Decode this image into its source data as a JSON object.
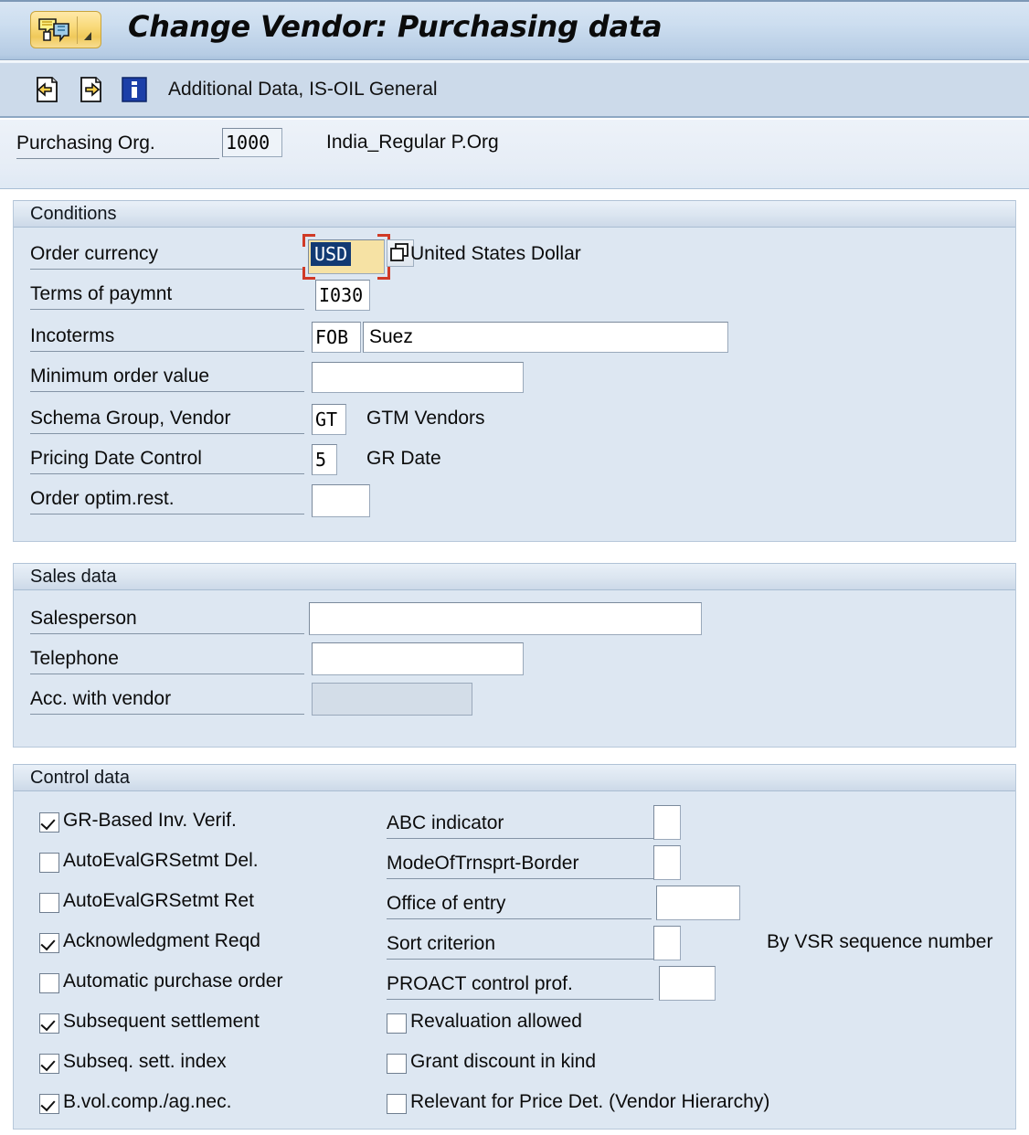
{
  "window": {
    "title": "Change Vendor: Purchasing data",
    "title_icon": "vendor-document-icon",
    "title_dropdown_icon": "caret-down-icon"
  },
  "toolbar": {
    "label": "Additional Data, IS-OIL General",
    "icons": [
      {
        "name": "previous-page-icon",
        "tooltip": "Previous screen"
      },
      {
        "name": "next-page-icon",
        "tooltip": "Next screen"
      },
      {
        "name": "info-icon",
        "tooltip": "Information"
      }
    ]
  },
  "header_fields": {
    "purchasing_org_label": "Purchasing Org.",
    "purchasing_org_value": "1000",
    "purchasing_org_description": "India_Regular P.Org"
  },
  "conditions": {
    "title": "Conditions",
    "order_currency": {
      "label": "Order currency",
      "value": "USD",
      "description": "United States Dollar",
      "focused": true,
      "copy_icon": "multiple-selection-icon"
    },
    "terms_of_paymnt": {
      "label": "Terms of paymnt",
      "value": "I030"
    },
    "incoterms": {
      "label": "Incoterms",
      "value": "FOB",
      "value2": "Suez"
    },
    "minimum_order_value": {
      "label": "Minimum order value",
      "value": ""
    },
    "schema_group_vendor": {
      "label": "Schema Group, Vendor",
      "value": "GT",
      "description": "GTM Vendors"
    },
    "pricing_date_control": {
      "label": "Pricing Date Control",
      "value": "5",
      "description": "GR Date"
    },
    "order_optim_rest": {
      "label": "Order optim.rest.",
      "value": ""
    }
  },
  "sales_data": {
    "title": "Sales data",
    "salesperson": {
      "label": "Salesperson",
      "value": ""
    },
    "telephone": {
      "label": "Telephone",
      "value": ""
    },
    "acc_with_vendor": {
      "label": "Acc. with vendor",
      "value": "",
      "disabled": true
    }
  },
  "control_data": {
    "title": "Control data",
    "checkboxes_left": [
      {
        "label": "GR-Based Inv. Verif.",
        "checked": true
      },
      {
        "label": "AutoEvalGRSetmt Del.",
        "checked": false
      },
      {
        "label": "AutoEvalGRSetmt Ret",
        "checked": false
      },
      {
        "label": "Acknowledgment Reqd",
        "checked": true
      },
      {
        "label": "Automatic purchase order",
        "checked": false
      },
      {
        "label": "Subsequent settlement",
        "checked": true
      },
      {
        "label": "Subseq. sett. index",
        "checked": true
      },
      {
        "label": "B.vol.comp./ag.nec.",
        "checked": true
      }
    ],
    "fields_right": [
      {
        "label": "ABC indicator",
        "value": ""
      },
      {
        "label": "ModeOfTrnsprt-Border",
        "value": ""
      },
      {
        "label": "Office of entry",
        "value": ""
      },
      {
        "label": "Sort criterion",
        "value": "",
        "description": "By VSR sequence number"
      },
      {
        "label": "PROACT control prof.",
        "value": ""
      }
    ],
    "checkboxes_right": [
      {
        "label": "Revaluation allowed",
        "checked": false
      },
      {
        "label": "Grant discount in kind",
        "checked": false
      },
      {
        "label": "Relevant for Price Det. (Vendor Hierarchy)",
        "checked": false
      }
    ]
  },
  "colors": {
    "titlebar_gradient_top": "#d9e6f3",
    "titlebar_gradient_bottom": "#a9c2dd",
    "toolbar_bg": "#ccdaea",
    "panel_bg": "#dde7f2",
    "focus_field_bg": "#f6e2a4",
    "selection_bg": "#123a73",
    "focus_frame": "#d03a27",
    "title_button": "#f8d877"
  }
}
